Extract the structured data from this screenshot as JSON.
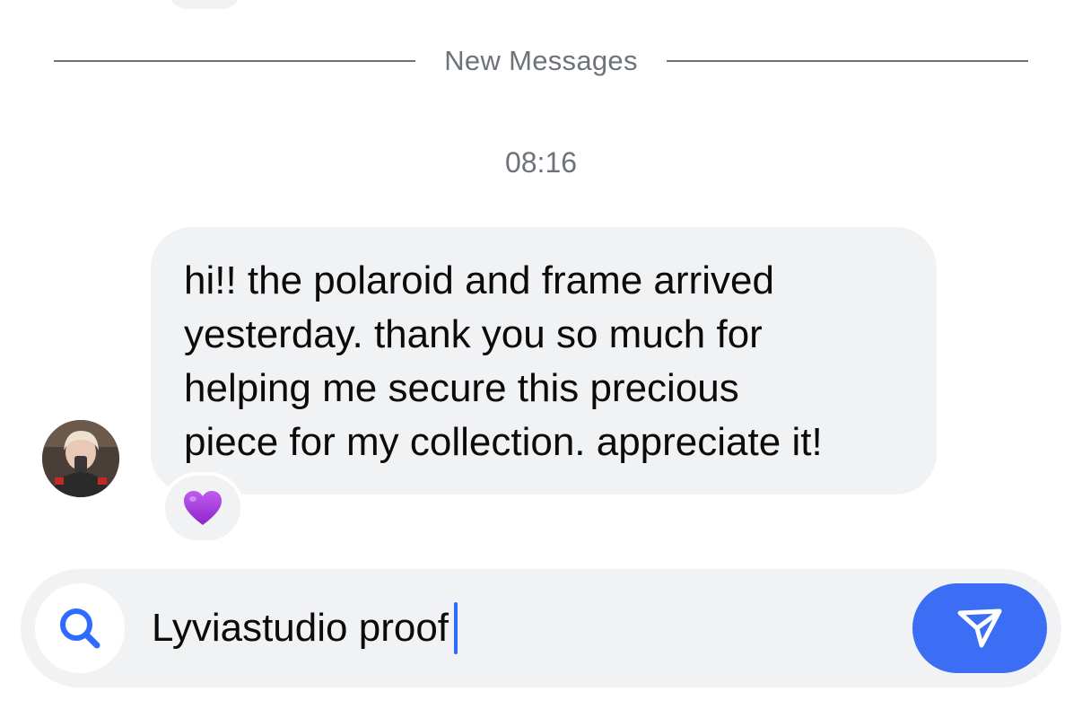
{
  "divider": {
    "label": "New Messages"
  },
  "timestamp": "08:16",
  "message": {
    "lines": [
      "hi!! the polaroid and frame arrived",
      "yesterday. thank you so much for",
      "helping me secure this precious",
      "piece for my collection. appreciate it!"
    ],
    "reaction": "purple-heart-icon"
  },
  "avatar": {
    "icon": "profile-photo"
  },
  "composer": {
    "value": "Lyviastudio proof",
    "search_icon": "search-icon",
    "send_icon": "send-icon"
  },
  "colors": {
    "bubble_bg": "#f1f2f4",
    "accent": "#3c6ef5",
    "search_icon": "#2f6bff",
    "muted_text": "#6e737a",
    "heart": "#a236d8"
  }
}
